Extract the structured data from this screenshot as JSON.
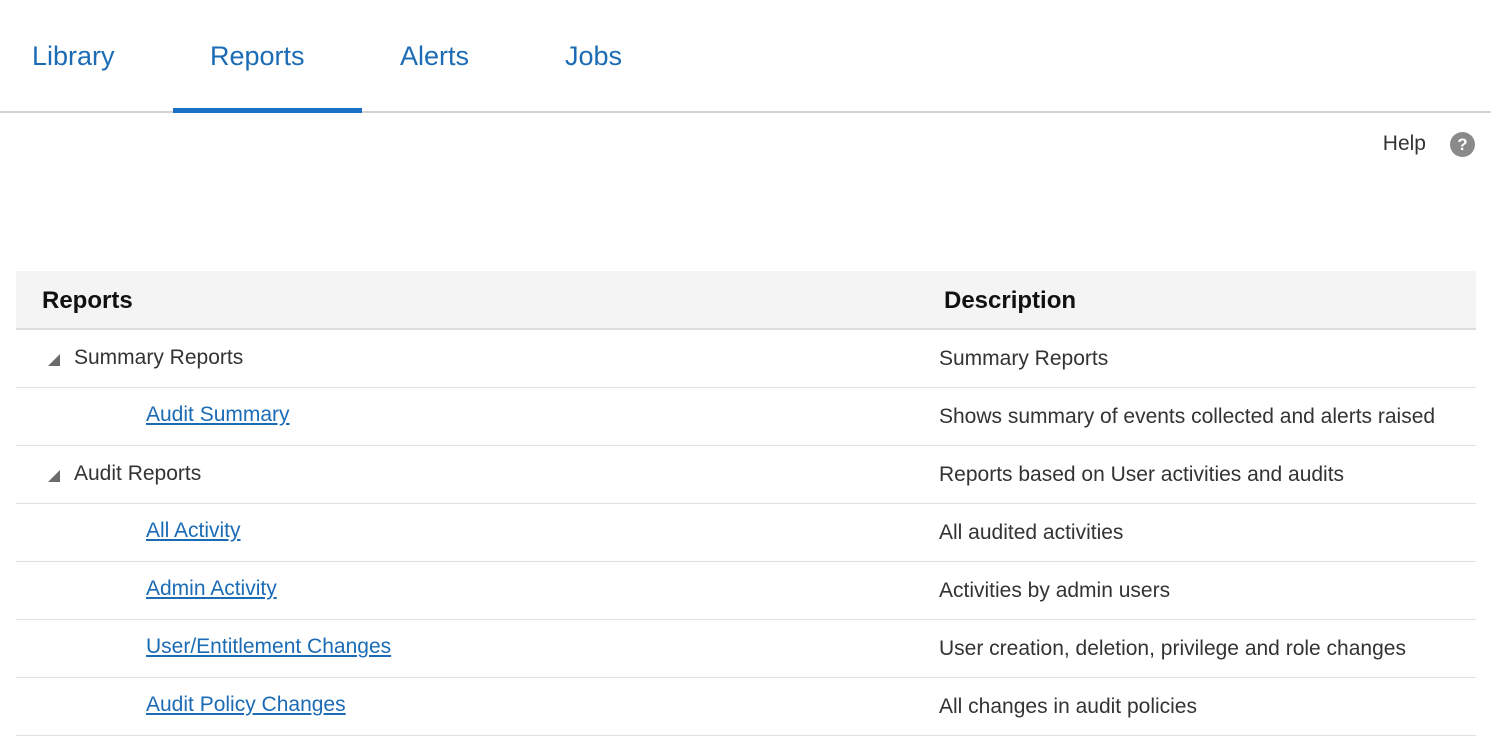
{
  "tabs": {
    "library": "Library",
    "reports": "Reports",
    "alerts": "Alerts",
    "jobs": "Jobs",
    "active": "Reports"
  },
  "help": {
    "label": "Help",
    "icon": "question-circle-icon",
    "icon_glyph": "?"
  },
  "table": {
    "headers": {
      "reports": "Reports",
      "description": "Description"
    },
    "rows": [
      {
        "type": "group",
        "name": "Summary Reports",
        "description": "Summary Reports",
        "expanded": true
      },
      {
        "type": "child",
        "name": "Audit Summary",
        "description": "Shows summary of events collected and alerts raised"
      },
      {
        "type": "group",
        "name": "Audit Reports",
        "description": "Reports based on User activities and audits",
        "expanded": true
      },
      {
        "type": "child",
        "name": "All Activity",
        "description": "All audited activities"
      },
      {
        "type": "child",
        "name": "Admin Activity",
        "description": "Activities by admin users"
      },
      {
        "type": "child",
        "name": "User/Entitlement Changes",
        "description": "User creation, deletion, privilege and role changes"
      },
      {
        "type": "child",
        "name": "Audit Policy Changes",
        "description": "All changes in audit policies"
      }
    ]
  },
  "colors": {
    "link": "#1b6bb5",
    "active_tab_underline": "#1b72c4",
    "header_bg": "#f4f4f4",
    "help_icon_bg": "#8a8a8a"
  }
}
